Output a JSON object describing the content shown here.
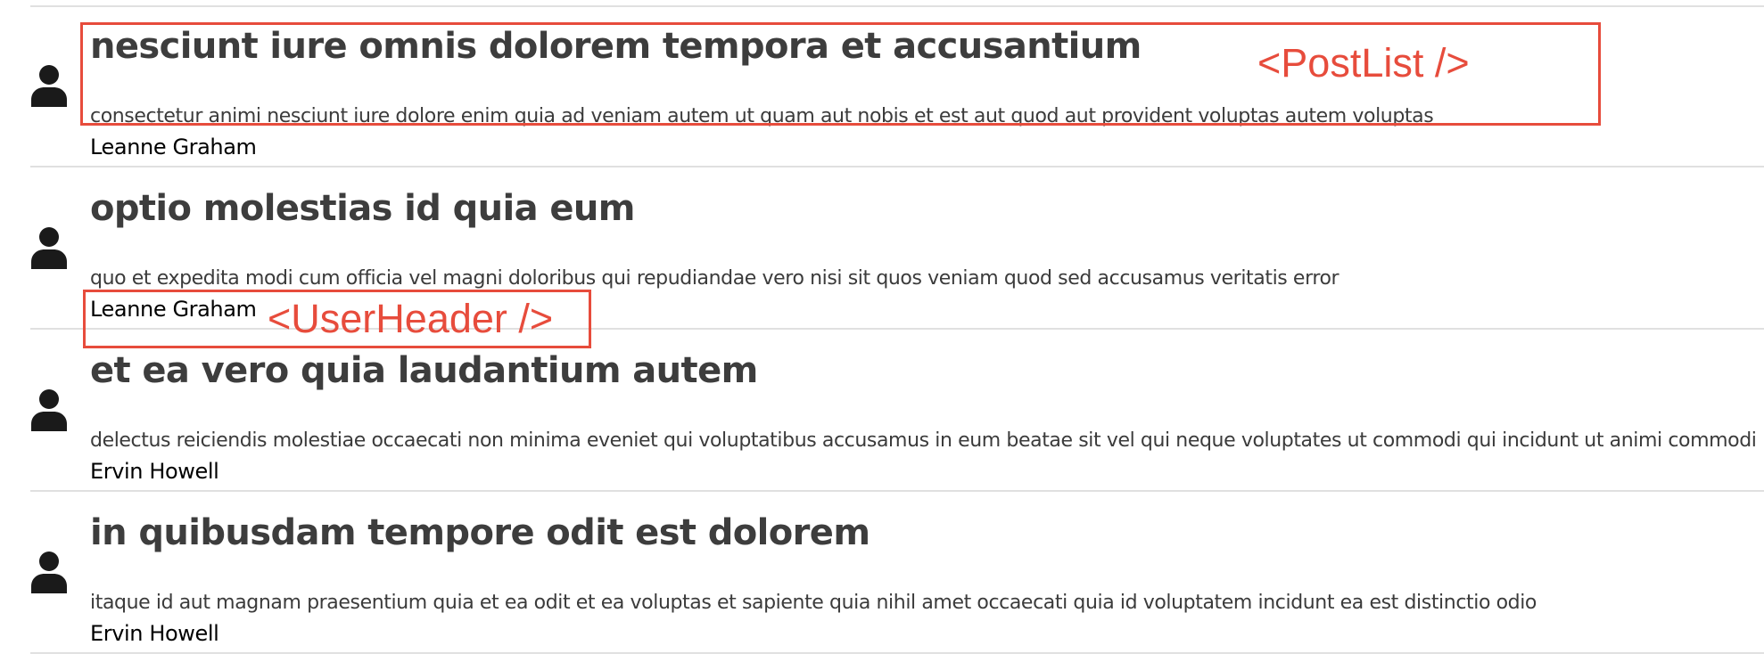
{
  "posts": [
    {
      "title": "nesciunt iure omnis dolorem tempora et accusantium",
      "body": "consectetur animi nesciunt iure dolore enim quia ad veniam autem ut quam aut nobis et est aut quod aut provident voluptas autem voluptas",
      "author": "Leanne Graham",
      "avatar_icon": "user-icon"
    },
    {
      "title": "optio molestias id quia eum",
      "body": "quo et expedita modi cum officia vel magni doloribus qui repudiandae vero nisi sit quos veniam quod sed accusamus veritatis error",
      "author": "Leanne Graham",
      "avatar_icon": "user-icon"
    },
    {
      "title": "et ea vero quia laudantium autem",
      "body": "delectus reiciendis molestiae occaecati non minima eveniet qui voluptatibus accusamus in eum beatae sit vel qui neque voluptates ut commodi qui incidunt ut animi commodi",
      "author": "Ervin Howell",
      "avatar_icon": "user-icon"
    },
    {
      "title": "in quibusdam tempore odit est dolorem",
      "body": "itaque id aut magnam praesentium quia et ea odit et ea voluptas et sapiente quia nihil amet occaecati quia id voluptatem incidunt ea est distinctio odio",
      "author": "Ervin Howell",
      "avatar_icon": "user-icon"
    }
  ],
  "annotations": {
    "post_list_label": "<PostList />",
    "user_header_label": "<UserHeader />",
    "color": "#e74c3c"
  },
  "colors": {
    "title": "#3d3d3d",
    "body": "#3b3b3b",
    "author": "#000000",
    "divider": "#e0e0e0",
    "avatar": "#1a1a1a"
  }
}
